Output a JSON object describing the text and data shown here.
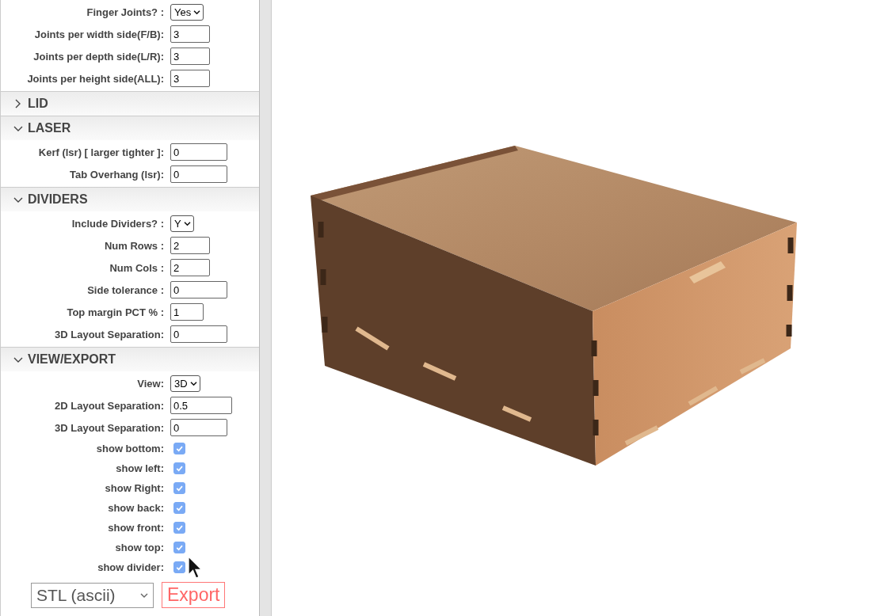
{
  "sections": [
    {
      "rows": [
        {
          "kind": "select",
          "label": "Finger Joints? :",
          "value": "Yes"
        },
        {
          "kind": "input",
          "label": "Joints per width side(F/B):",
          "value": "3"
        },
        {
          "kind": "input",
          "label": "Joints per depth side(L/R):",
          "value": "3"
        },
        {
          "kind": "input",
          "label": "Joints per height side(ALL):",
          "value": "3"
        }
      ]
    },
    {
      "title": "LID",
      "expanded": false
    },
    {
      "title": "LASER",
      "expanded": true,
      "rows": [
        {
          "kind": "wide-input",
          "label": "Kerf (lsr) [ larger tighter ]:",
          "value": "0"
        },
        {
          "kind": "wide-input",
          "label": "Tab Overhang (lsr):",
          "value": "0"
        }
      ]
    },
    {
      "title": "DIVIDERS",
      "expanded": true,
      "rows": [
        {
          "kind": "select",
          "label": "Include Dividers? :",
          "value": "Y"
        },
        {
          "kind": "input",
          "label": "Num Rows :",
          "value": "2"
        },
        {
          "kind": "input",
          "label": "Num Cols :",
          "value": "2"
        },
        {
          "kind": "wide-input",
          "label": "Side tolerance :",
          "value": "0"
        },
        {
          "kind": "small-input",
          "label": "Top margin PCT % :",
          "value": "1"
        },
        {
          "kind": "wide-input",
          "label": "3D Layout Separation:",
          "value": "0"
        }
      ]
    },
    {
      "title": "VIEW/EXPORT",
      "expanded": true,
      "rows": [
        {
          "kind": "select",
          "label": "View:",
          "value": "3D"
        },
        {
          "kind": "wider-input",
          "label": "2D Layout Separation:",
          "value": "0.5"
        },
        {
          "kind": "wide-input",
          "label": "3D Layout Separation:",
          "value": "0"
        },
        {
          "kind": "checkbox",
          "label": "show bottom:",
          "checked": true
        },
        {
          "kind": "checkbox",
          "label": "show left:",
          "checked": true
        },
        {
          "kind": "checkbox",
          "label": "show Right:",
          "checked": true
        },
        {
          "kind": "checkbox",
          "label": "show back:",
          "checked": true
        },
        {
          "kind": "checkbox",
          "label": "show front:",
          "checked": true
        },
        {
          "kind": "checkbox",
          "label": "show top:",
          "checked": true
        },
        {
          "kind": "checkbox",
          "label": "show divider:",
          "checked": true
        }
      ]
    }
  ],
  "export": {
    "format": "STL (ascii)",
    "button": "Export"
  }
}
